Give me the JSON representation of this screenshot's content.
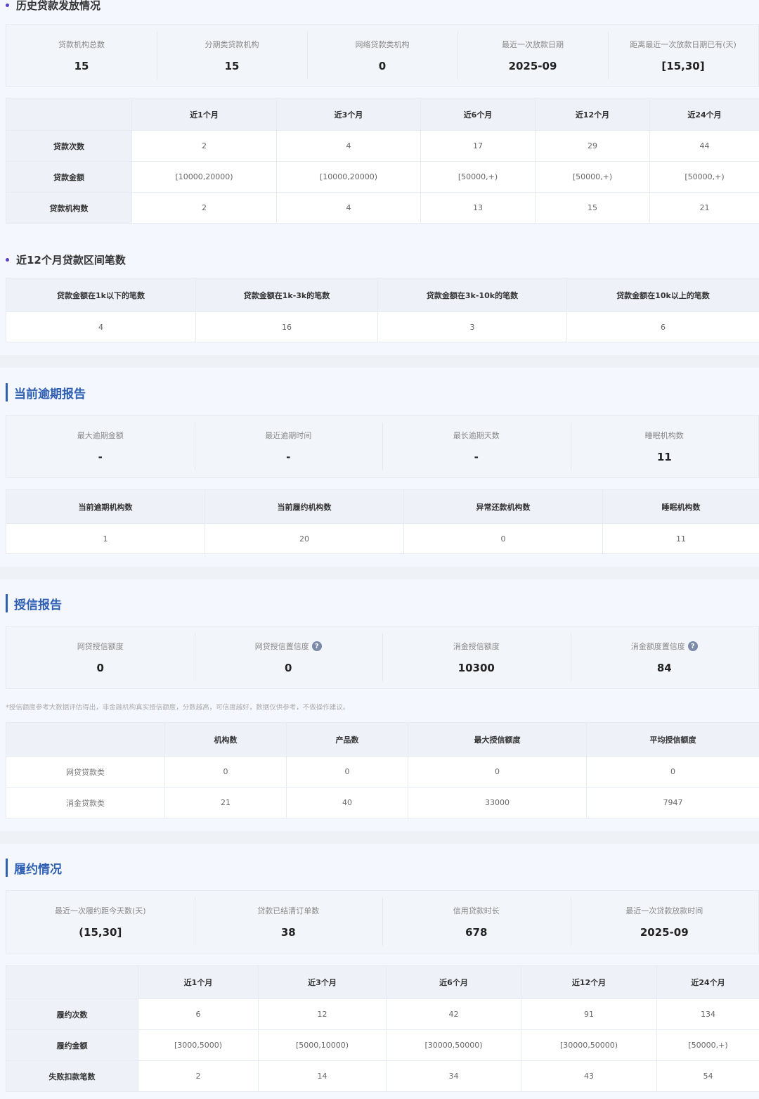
{
  "history": {
    "title": "历史贷款发放情况",
    "stats": [
      {
        "label": "贷款机构总数",
        "value": "15"
      },
      {
        "label": "分期类贷款机构",
        "value": "15"
      },
      {
        "label": "网络贷款类机构",
        "value": "0"
      },
      {
        "label": "最近一次放款日期",
        "value": "2025-09"
      },
      {
        "label": "距离最近一次放款日期已有(天)",
        "value": "[15,30]"
      }
    ],
    "table": {
      "headers": [
        "",
        "近1个月",
        "近3个月",
        "近6个月",
        "近12个月",
        "近24个月"
      ],
      "rows": [
        [
          "贷款次数",
          "2",
          "4",
          "17",
          "29",
          "44"
        ],
        [
          "贷款金额",
          "[10000,20000)",
          "[10000,20000)",
          "[50000,+)",
          "[50000,+)",
          "[50000,+)"
        ],
        [
          "贷款机构数",
          "2",
          "4",
          "13",
          "15",
          "21"
        ]
      ]
    }
  },
  "interval": {
    "title": "近12个月贷款区间笔数",
    "headers": [
      "贷款金额在1k以下的笔数",
      "贷款金额在1k-3k的笔数",
      "贷款金额在3k-10k的笔数",
      "贷款金额在10k以上的笔数"
    ],
    "values": [
      "4",
      "16",
      "3",
      "6"
    ]
  },
  "overdue": {
    "title": "当前逾期报告",
    "stats": [
      {
        "label": "最大逾期金额",
        "value": "-"
      },
      {
        "label": "最近逾期时间",
        "value": "-"
      },
      {
        "label": "最长逾期天数",
        "value": "-"
      },
      {
        "label": "睡眠机构数",
        "value": "11"
      }
    ],
    "headers": [
      "当前逾期机构数",
      "当前履约机构数",
      "异常还款机构数",
      "睡眠机构数"
    ],
    "values": [
      "1",
      "20",
      "0",
      "11"
    ]
  },
  "credit": {
    "title": "授信报告",
    "stats": [
      {
        "label": "网贷授信额度",
        "value": "0",
        "help": false
      },
      {
        "label": "网贷授信置信度",
        "value": "0",
        "help": true
      },
      {
        "label": "消金授信额度",
        "value": "10300",
        "help": false
      },
      {
        "label": "消金额度置信度",
        "value": "84",
        "help": true
      }
    ],
    "note": "*授信额度参考大数据评估得出，非金融机构真实授信额度，分数越高，可信度越好，数据仅供参考，不做操作建议。",
    "help_glyph": "?",
    "headers": [
      "",
      "机构数",
      "产品数",
      "最大授信额度",
      "平均授信额度"
    ],
    "rows": [
      [
        "网贷贷款类",
        "0",
        "0",
        "0",
        "0"
      ],
      [
        "消金贷款类",
        "21",
        "40",
        "33000",
        "7947"
      ]
    ]
  },
  "performance": {
    "title": "履约情况",
    "stats": [
      {
        "label": "最近一次履约距今天数(天)",
        "value": "(15,30]"
      },
      {
        "label": "贷款已结清订单数",
        "value": "38"
      },
      {
        "label": "信用贷款时长",
        "value": "678"
      },
      {
        "label": "最近一次贷款放款时间",
        "value": "2025-09"
      }
    ],
    "table": {
      "headers": [
        "",
        "近1个月",
        "近3个月",
        "近6个月",
        "近12个月",
        "近24个月"
      ],
      "rows": [
        [
          "履约次数",
          "6",
          "12",
          "42",
          "91",
          "134"
        ],
        [
          "履约金额",
          "[3000,5000)",
          "[5000,10000)",
          "[30000,50000)",
          "[30000,50000)",
          "[50000,+)"
        ],
        [
          "失败扣款笔数",
          "2",
          "14",
          "34",
          "43",
          "54"
        ]
      ]
    }
  }
}
